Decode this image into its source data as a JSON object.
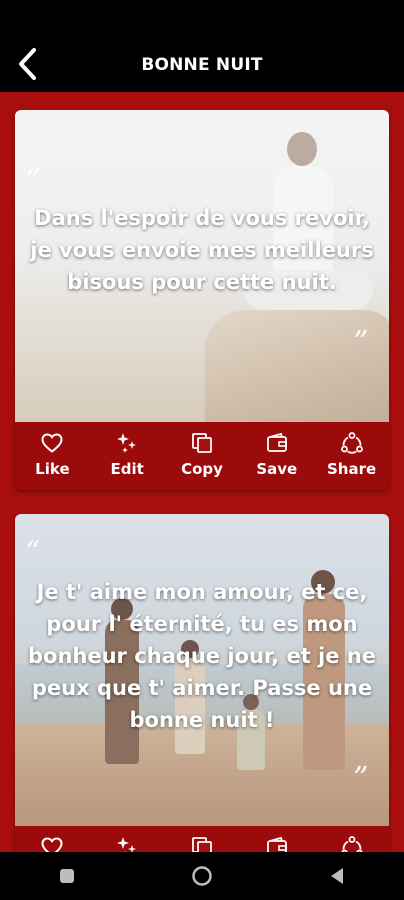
{
  "header": {
    "title": "BONNE NUIT",
    "back_icon": "arrow-left-icon"
  },
  "quotes": [
    {
      "text": "Dans l'espoir de vous revoir, je vous envoie mes meilleurs bisous pour cette nuit.",
      "open_mark": "“",
      "close_mark": "”"
    },
    {
      "text": "Je t' aime mon amour, et ce, pour l' éternité, tu es mon bonheur chaque jour, et je ne peux que t' aimer.  Passe une bonne nuit !",
      "open_mark": "“",
      "close_mark": "”"
    }
  ],
  "actions": {
    "like": "Like",
    "edit": "Edit",
    "copy": "Copy",
    "save": "Save",
    "share": "Share"
  },
  "colors": {
    "background": "#a80e0e",
    "header": "#000000",
    "text": "#ffffff"
  },
  "navbar": {
    "icons": [
      "recent-apps-icon",
      "home-icon",
      "back-icon"
    ]
  }
}
